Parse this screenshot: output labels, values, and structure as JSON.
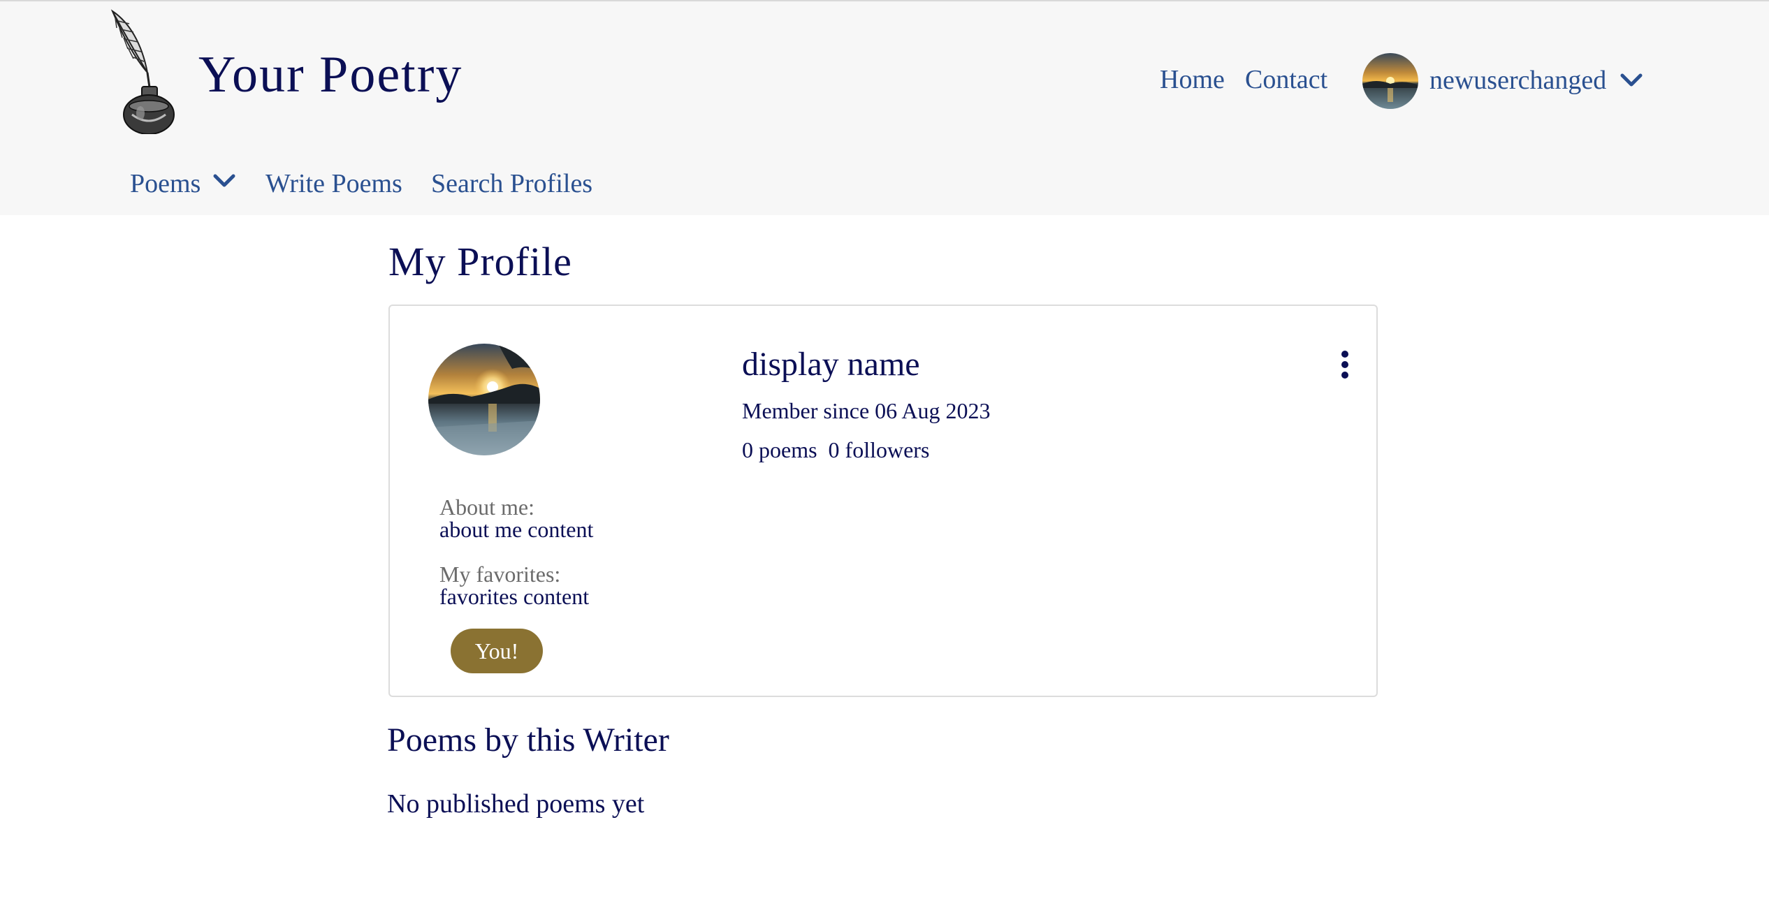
{
  "header": {
    "brand": "Your Poetry",
    "nav": {
      "home": "Home",
      "contact": "Contact"
    },
    "user": {
      "name": "newuserchanged"
    },
    "subnav": {
      "poems": "Poems",
      "write": "Write Poems",
      "search": "Search Profiles"
    }
  },
  "main": {
    "page_title": "My Profile",
    "profile": {
      "display_name": "display name",
      "member_since": "Member since 06 Aug 2023",
      "poems_count": "0 poems",
      "followers_count": "0 followers",
      "about_label": "About me:",
      "about_value": "about me content",
      "favorites_label": "My favorites:",
      "favorites_value": "favorites content",
      "badge": "You!"
    },
    "poems_section_title": "Poems by this Writer",
    "empty_message": "No published poems yet"
  },
  "colors": {
    "navy_text": "#0b0f55",
    "link_blue": "#2a5090",
    "header_bg": "#f7f7f7",
    "badge_bg": "#8a7232"
  },
  "icons": {
    "logo": "quill-inkwell-icon",
    "dropdown": "chevron-down-icon",
    "menu": "kebab-menu-icon"
  }
}
